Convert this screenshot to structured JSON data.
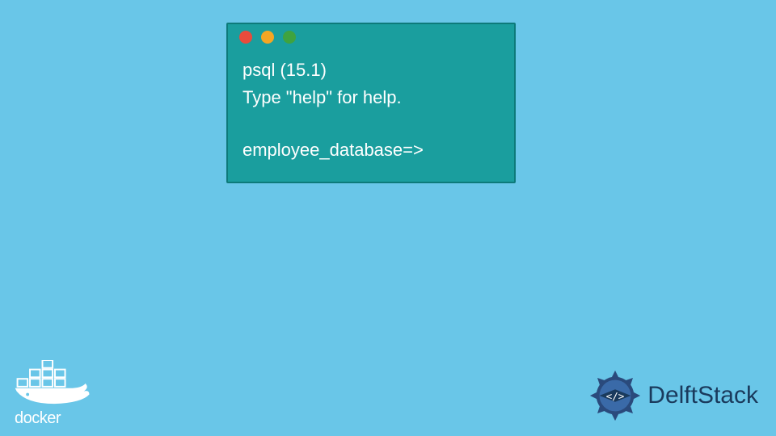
{
  "terminal": {
    "line1": "psql (15.1)",
    "line2": "Type \"help\" for help.",
    "prompt": "employee_database=>"
  },
  "logos": {
    "docker_label": "docker",
    "delftstack_label": "DelftStack"
  }
}
